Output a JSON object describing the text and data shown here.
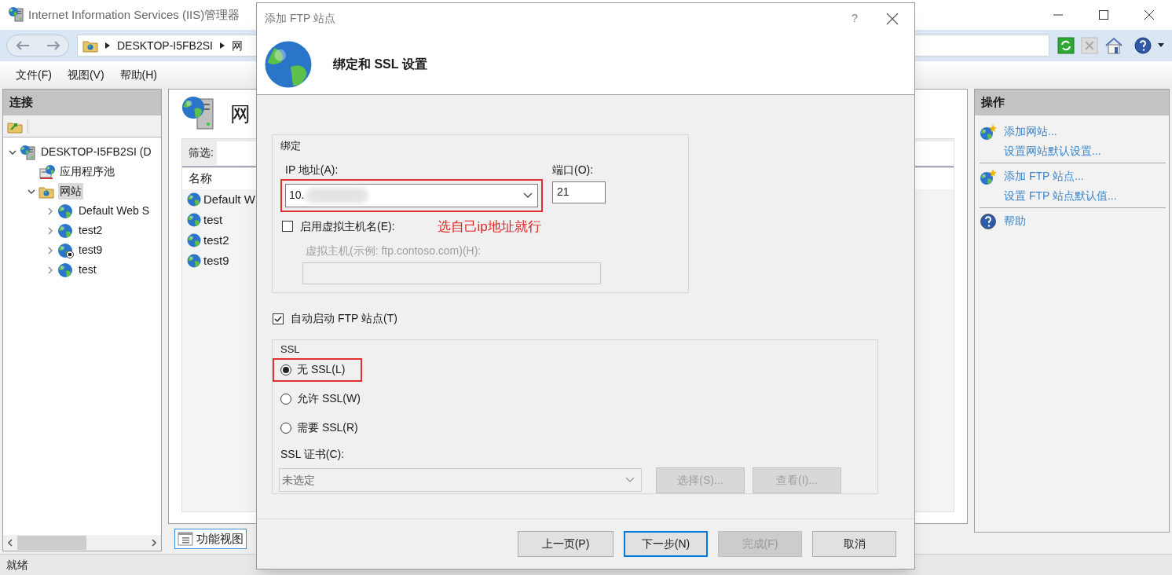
{
  "window": {
    "title": "Internet Information Services (IIS)管理器"
  },
  "address_bar": {
    "path": [
      "DESKTOP-I5FB2SI",
      "网"
    ]
  },
  "menu": [
    "文件(F)",
    "视图(V)",
    "帮助(H)"
  ],
  "connections": {
    "title": "连接",
    "tree": [
      {
        "label": "DESKTOP-I5FB2SI (D",
        "kind": "server",
        "expanded": true,
        "selected": false,
        "children": [
          {
            "label": "应用程序池",
            "kind": "pool",
            "selected": false
          },
          {
            "label": "网站",
            "kind": "sites",
            "expanded": true,
            "selected": true,
            "children": [
              {
                "label": "Default Web S",
                "kind": "site",
                "expanded": false,
                "stopped": false,
                "selected": false
              },
              {
                "label": "test2",
                "kind": "site",
                "expanded": false,
                "stopped": false,
                "selected": false
              },
              {
                "label": "test9",
                "kind": "site",
                "expanded": false,
                "stopped": true,
                "selected": false
              },
              {
                "label": "test",
                "kind": "site",
                "expanded": false,
                "stopped": false,
                "selected": false
              }
            ]
          }
        ]
      }
    ]
  },
  "sites_view": {
    "title": "网",
    "filter_label": "筛选:",
    "column": "名称",
    "rows": [
      "Default W",
      "test",
      "test2",
      "test9"
    ],
    "tabs": [
      {
        "label": "功能视图",
        "selected": true
      }
    ]
  },
  "actions": {
    "title": "操作",
    "groups": [
      [
        {
          "label": "添加网站...",
          "kind": "add"
        },
        {
          "label": "设置网站默认设置...",
          "kind": "plain"
        }
      ],
      [
        {
          "label": "添加 FTP 站点...",
          "kind": "add"
        },
        {
          "label": "设置 FTP 站点默认值...",
          "kind": "plain"
        }
      ],
      [
        {
          "label": "帮助",
          "kind": "help"
        }
      ]
    ]
  },
  "status_bar": "就绪",
  "dialog": {
    "title": "添加 FTP 站点",
    "help": "?",
    "heading": "绑定和 SSL 设置",
    "binding": {
      "group_label": "绑定",
      "ip_label": "IP 地址(A):",
      "ip_value": "10.",
      "ip_highlighted": true,
      "port_label": "端口(O):",
      "port_value": "21",
      "virtual_host": {
        "label": "启用虚拟主机名(E):",
        "checked": false
      },
      "host_label": "虚拟主机(示例: ftp.contoso.com)(H):"
    },
    "annotation": "选自己ip地址就行",
    "autostart": {
      "label": "自动启动 FTP 站点(T)",
      "checked": true
    },
    "ssl": {
      "group_label": "SSL",
      "options": [
        {
          "label": "无 SSL(L)",
          "selected": true,
          "highlighted": true
        },
        {
          "label": "允许 SSL(W)",
          "selected": false,
          "highlighted": false
        },
        {
          "label": "需要 SSL(R)",
          "selected": false,
          "highlighted": false
        }
      ],
      "cert_label": "SSL 证书(C):",
      "cert_value": "未选定",
      "buttons": [
        {
          "label": "选择(S)...",
          "disabled": true
        },
        {
          "label": "查看(I)...",
          "disabled": true
        }
      ]
    },
    "buttons": [
      {
        "label": "上一页(P)",
        "disabled": false,
        "default": false
      },
      {
        "label": "下一步(N)",
        "disabled": false,
        "default": true
      },
      {
        "label": "完成(F)",
        "disabled": true,
        "default": false
      },
      {
        "label": "取消",
        "disabled": false,
        "default": false
      }
    ]
  }
}
